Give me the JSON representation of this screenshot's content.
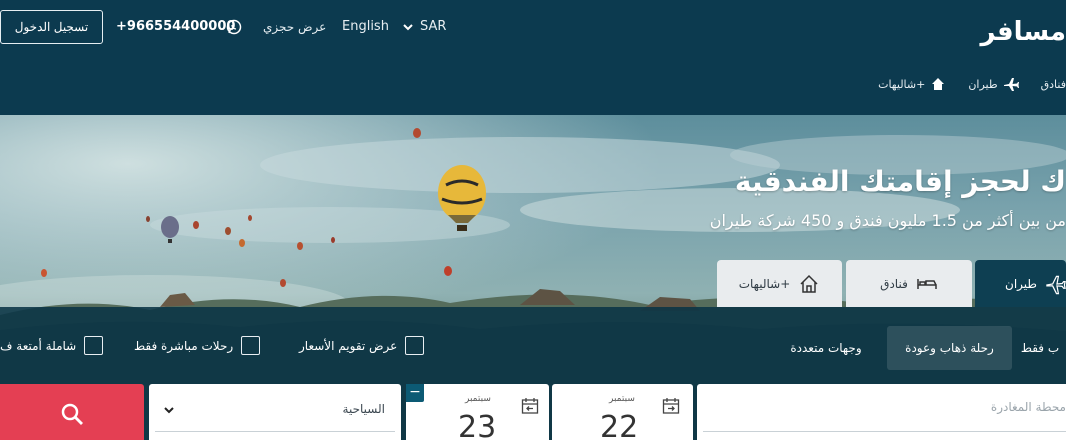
{
  "header": {
    "login_label": "تسجيل الدخول",
    "phone": "+966554400000",
    "booking_label": "عرض حجزي",
    "language_label": "English",
    "currency_label": "SAR",
    "logo_text": "مسافر",
    "nav": [
      {
        "label": "فنادق",
        "icon": "hotel-icon"
      },
      {
        "label": "طيران",
        "icon": "airplane-icon"
      },
      {
        "label": "شاليهات+",
        "icon": "house-icon"
      }
    ]
  },
  "hero": {
    "title": "ك لحجز إقامتك الفندقية",
    "subtitle": "من بين أكثر من 1.5 مليون فندق و 450 شركة طيران"
  },
  "tabs": {
    "flights": "طيران",
    "hotels": "فنادق",
    "chalets": "شاليهات+"
  },
  "options": {
    "trip_types": {
      "one_way": "ب فقط",
      "round_trip": "رحلة ذهاب وعودة",
      "multi_city": "وجهات متعددة"
    },
    "checkboxes": {
      "price_calendar": "عرض تقويم الأسعار",
      "direct_only": "رحلات مباشرة فقط",
      "baggage_included": "شاملة أمتعة ف"
    }
  },
  "form": {
    "origin_placeholder": "محطة المغادرة",
    "departure": {
      "month": "سبتمبر",
      "day": "22"
    },
    "return": {
      "month": "سبتمبر",
      "day": "23"
    },
    "cabin_value": "السياحية",
    "return_toggle": "−"
  },
  "colors": {
    "header_bg": "#0c3a4f",
    "search_button": "#e43f53",
    "active_tab": "#0e3f52"
  }
}
